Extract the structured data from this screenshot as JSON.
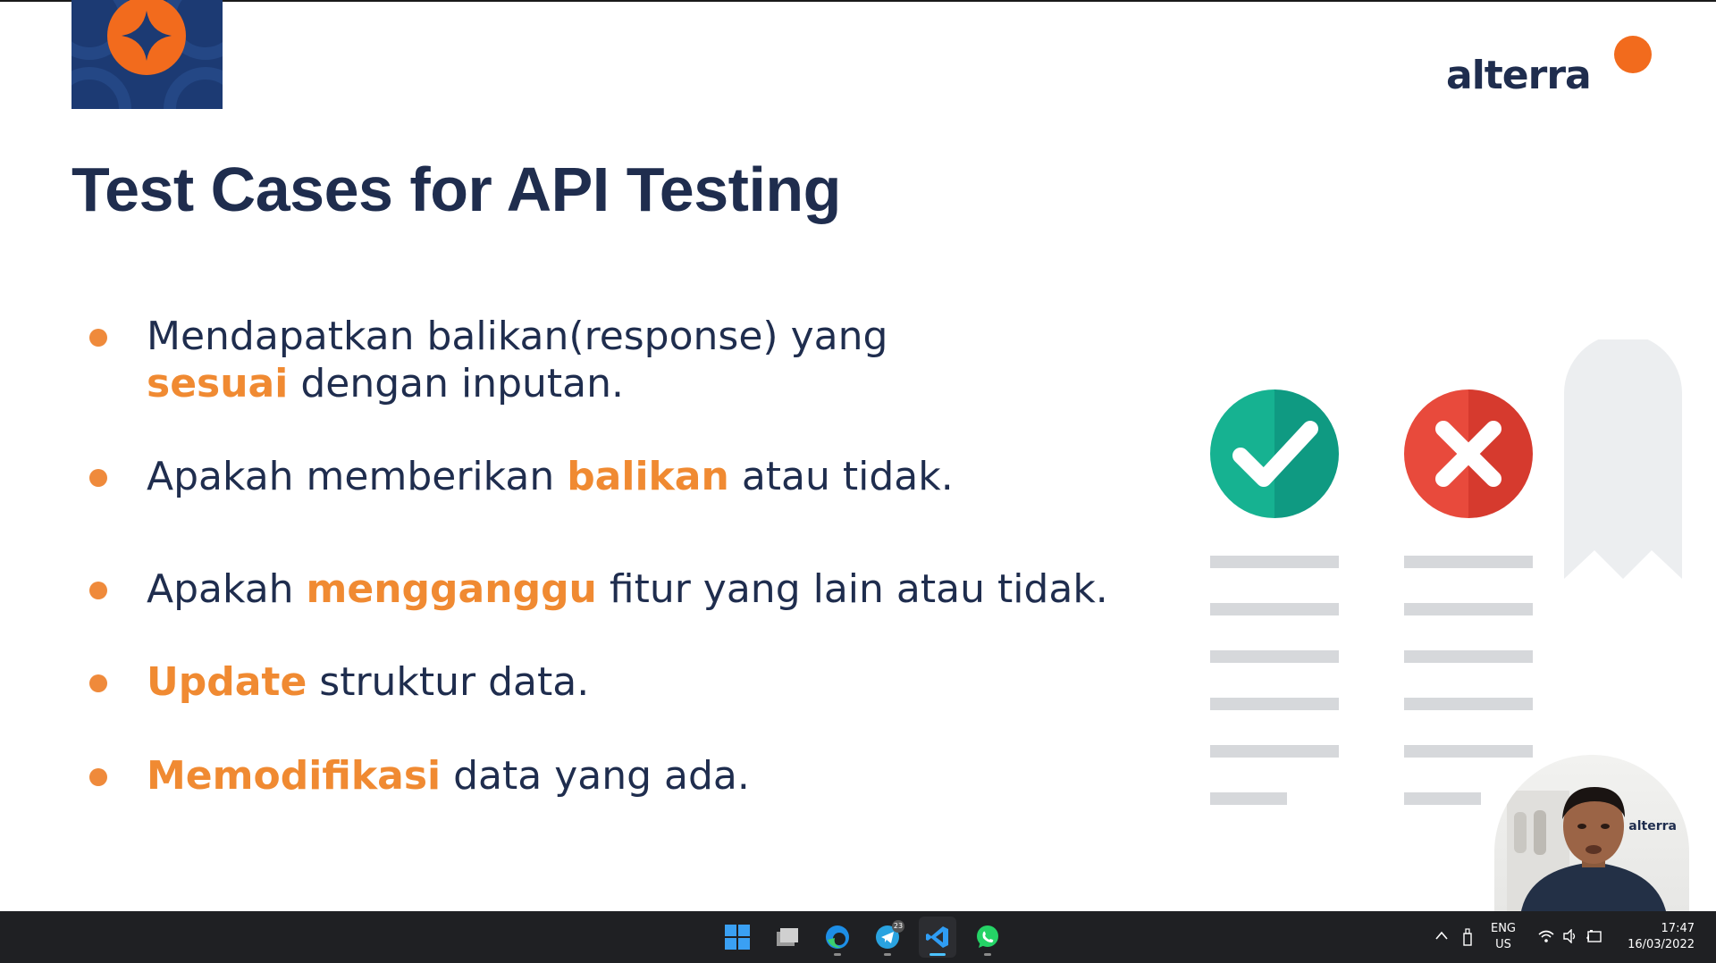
{
  "slide": {
    "title": "Test Cases for API Testing",
    "brand": "alterra",
    "bullets": [
      {
        "parts": [
          {
            "text": "Mendapatkan balikan(response) yang"
          }
        ]
      },
      {
        "parts": [
          {
            "text": "sesuai",
            "highlight": true
          },
          {
            "text": " dengan inputan."
          }
        ]
      },
      {
        "parts": [
          {
            "text": "Apakah memberikan "
          },
          {
            "text": "balikan",
            "highlight": true
          },
          {
            "text": " atau tidak."
          }
        ]
      },
      {
        "parts": [
          {
            "text": "Apakah "
          },
          {
            "text": "mengganggu",
            "highlight": true
          },
          {
            "text": " fitur yang lain atau tidak."
          }
        ]
      },
      {
        "parts": [
          {
            "text": "Update",
            "highlight": true
          },
          {
            "text": " struktur data."
          }
        ]
      },
      {
        "parts": [
          {
            "text": "Memodifikasi",
            "highlight": true
          },
          {
            "text": " data yang ada."
          }
        ]
      }
    ],
    "illustration": {
      "left_icon": "check-icon",
      "right_icon": "x-icon"
    },
    "colors": {
      "navy": "#1f2d4e",
      "orange": "#f08a32",
      "green": "#16b291",
      "red": "#e84a3c"
    }
  },
  "webcam": {
    "overlay_text": "alterra"
  },
  "taskbar": {
    "apps": [
      {
        "name": "start-button",
        "icon": "windows-icon"
      },
      {
        "name": "file-explorer-button",
        "icon": "folder-icon"
      },
      {
        "name": "edge-button",
        "icon": "edge-icon"
      },
      {
        "name": "telegram-button",
        "icon": "telegram-icon",
        "badge": "23"
      },
      {
        "name": "vscode-button",
        "icon": "vscode-icon",
        "active": true
      },
      {
        "name": "whatsapp-button",
        "icon": "whatsapp-icon"
      }
    ],
    "tray": {
      "lang_line1": "ENG",
      "lang_line2": "US",
      "time": "17:47",
      "date": "16/03/2022"
    }
  }
}
